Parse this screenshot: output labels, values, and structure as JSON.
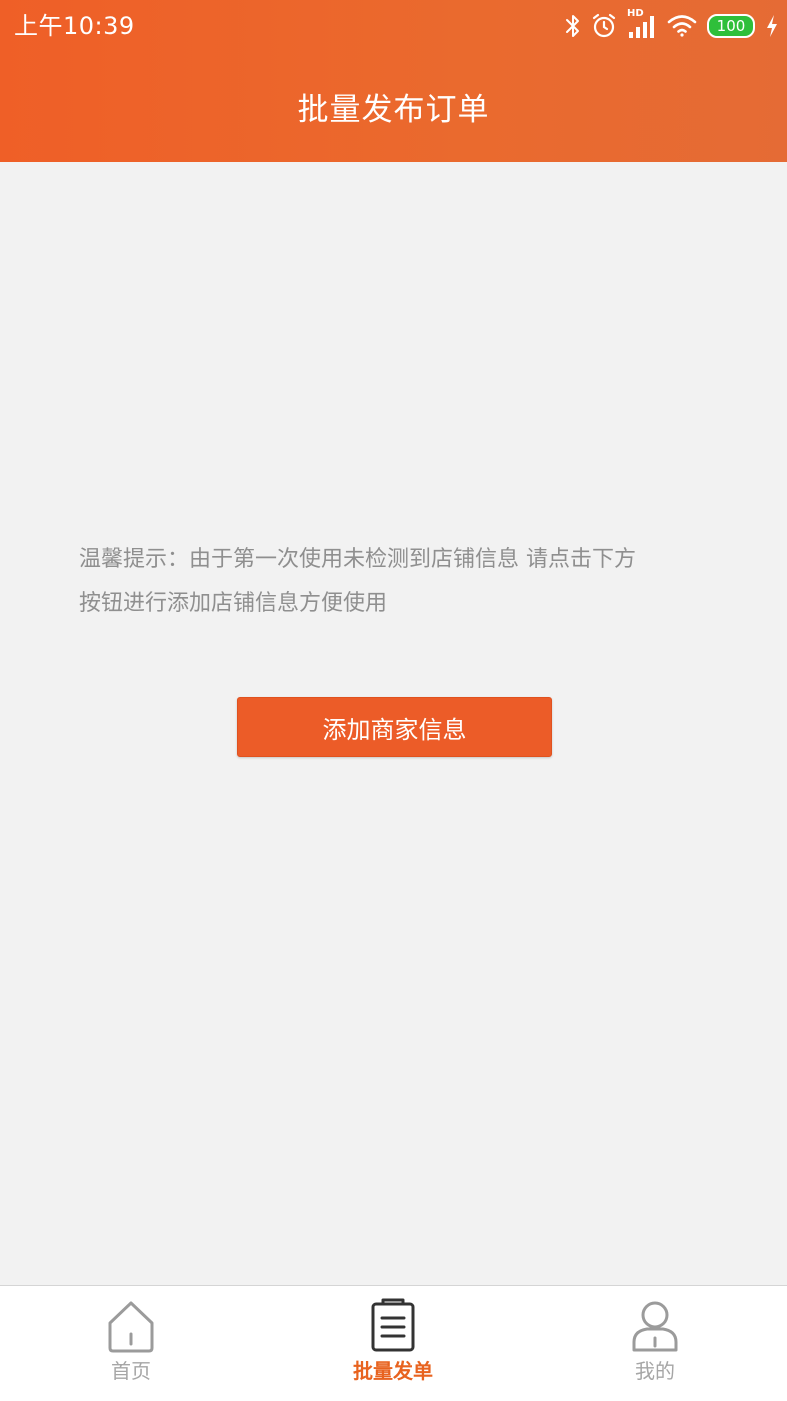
{
  "status_bar": {
    "time": "上午10:39",
    "network_badge": "HD",
    "battery_level": "100",
    "icons": [
      "bluetooth-icon",
      "alarm-icon",
      "signal-icon",
      "wifi-icon",
      "battery-icon",
      "charging-icon"
    ]
  },
  "header": {
    "title": "批量发布订单"
  },
  "main": {
    "tip_line1": "温馨提示：由于第一次使用未检测到店铺信息 请点击下方",
    "tip_line2": "按钮进行添加店铺信息方便使用",
    "add_button_label": "添加商家信息"
  },
  "tabbar": {
    "tabs": [
      {
        "label": "首页",
        "icon": "home-icon",
        "active": false
      },
      {
        "label": "批量发单",
        "icon": "clipboard-list-icon",
        "active": true
      },
      {
        "label": "我的",
        "icon": "user-icon",
        "active": false
      }
    ]
  },
  "colors": {
    "brand": "#ec5c28",
    "active_tab": "#e8631f",
    "inactive_tab": "#a6a6a6",
    "tip_text": "#8f8f8f",
    "background": "#f2f2f2"
  }
}
